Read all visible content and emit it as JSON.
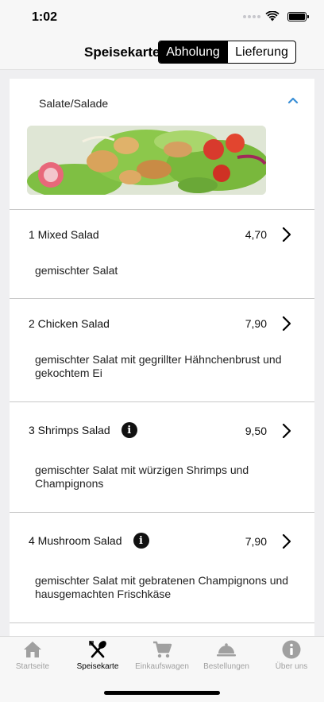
{
  "status_bar": {
    "time": "1:02"
  },
  "nav": {
    "title": "Speisekarte",
    "segments": [
      {
        "label": "Abholung",
        "selected": true
      },
      {
        "label": "Lieferung",
        "selected": false
      }
    ]
  },
  "section": {
    "title": "Salate/Salade",
    "image_icon": "salad-photo"
  },
  "items": [
    {
      "name": "1 Mixed Salad",
      "price": "4,70",
      "has_info": false,
      "desc": "gemischter Salat"
    },
    {
      "name": "2 Chicken Salad",
      "price": "7,90",
      "has_info": false,
      "desc": "gemischter Salat mit gegrillter Hähnchenbrust und gekochtem Ei"
    },
    {
      "name": "3 Shrimps Salad",
      "price": "9,50",
      "has_info": true,
      "desc": "gemischter Salat mit würzigen Shrimps und Champignons"
    },
    {
      "name": "4 Mushroom Salad",
      "price": "7,90",
      "has_info": true,
      "desc": "gemischter Salat mit gebratenen Champignons und hausgemachten Frischkäse"
    }
  ],
  "tabs": [
    {
      "label": "Startseite",
      "icon": "home-icon",
      "active": false
    },
    {
      "label": "Speisekarte",
      "icon": "cutlery-icon",
      "active": true
    },
    {
      "label": "Einkaufswagen",
      "icon": "cart-icon",
      "active": false
    },
    {
      "label": "Bestellungen",
      "icon": "cloche-icon",
      "active": false
    },
    {
      "label": "Über uns",
      "icon": "info-icon",
      "active": false
    }
  ],
  "colors": {
    "accent": "#3a8fd6",
    "tab_inactive": "#a0a0a0",
    "tab_active": "#000000"
  }
}
